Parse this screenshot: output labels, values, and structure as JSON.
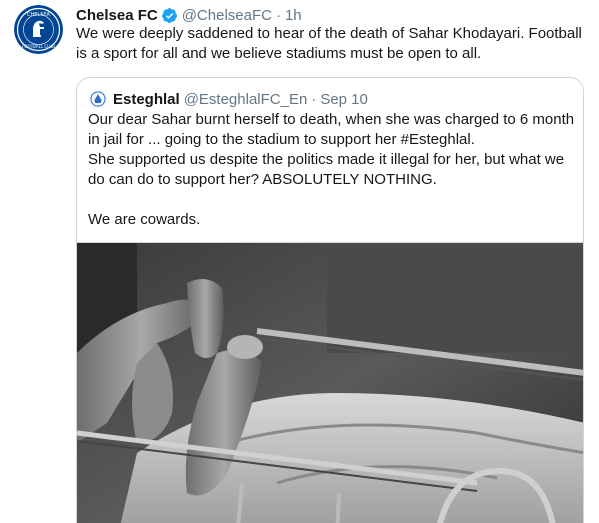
{
  "tweet": {
    "author_name": "Chelsea FC",
    "handle": "@ChelseaFC",
    "separator": "·",
    "time": "1h",
    "text": "We were deeply saddened to hear of the death of Sahar Khodayari. Football is a sport for all and we believe stadiums must be open to all.",
    "avatar_icon": "chelsea-crest-icon",
    "verified_icon": "verified-badge-icon",
    "accent_color": "#1da1f2",
    "brand_color": "#034694"
  },
  "quote": {
    "author_name": "Esteghlal",
    "handle": "@EsteghlalFC_En",
    "separator": "·",
    "date": "Sep 10",
    "avatar_icon": "esteghlal-crest-icon",
    "paragraphs": [
      "Our dear Sahar burnt herself to death, when she was charged to 6 month in jail for ... going to the stadium to support her #Esteghlal.",
      "She supported us despite the politics made it illegal for her, but what we do can do to support her? ABSOLUTELY NOTHING.",
      "We are cowards."
    ],
    "media": "black-and-white photo of a bandaged person lying on a hospital bed"
  }
}
